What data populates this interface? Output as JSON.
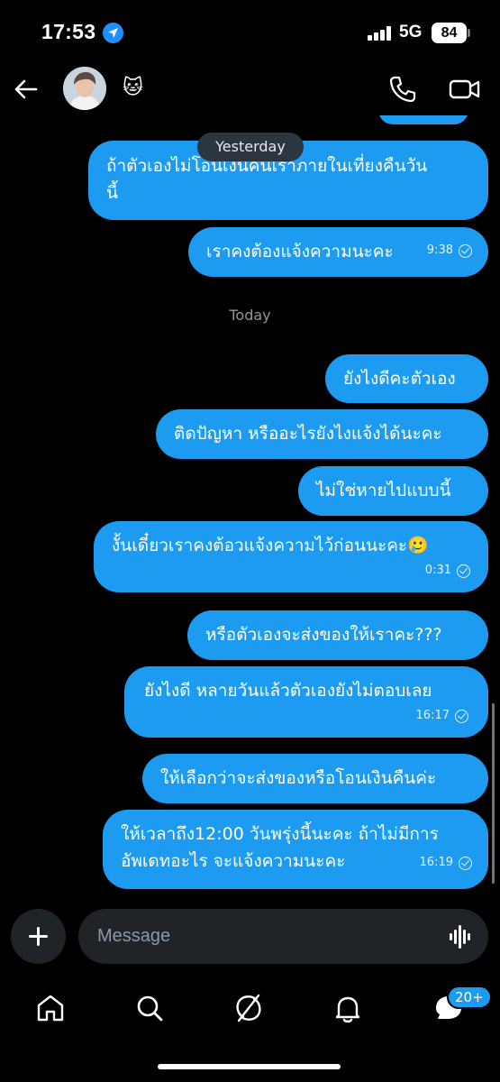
{
  "status_bar": {
    "time": "17:53",
    "network": "5G",
    "battery": "84",
    "signal_bars": 4,
    "location_icon": "location-arrow-icon"
  },
  "header": {
    "back_icon": "back-arrow-icon",
    "contact_emoji": "🐱",
    "call_icon": "phone-icon",
    "video_icon": "video-camera-icon"
  },
  "chat": {
    "yesterday_label": "Yesterday",
    "today_label": "Today",
    "messages": [
      {
        "lines": [
          "ถ้าตัวเองไม่โอนเงินคืนเราภายในเที่ยงคืนวัน",
          "นี้"
        ],
        "time": ""
      },
      {
        "lines": [
          "เราคงต้องแจ้งความนะคะ"
        ],
        "time": "9:38"
      },
      {
        "lines": [
          "ยังไงดีคะตัวเอง"
        ],
        "time": ""
      },
      {
        "lines": [
          "ติดปัญหา หรืออะไรยังไงแจ้งได้นะคะ"
        ],
        "time": ""
      },
      {
        "lines": [
          "ไม่ใช่หายไปแบบนี้"
        ],
        "time": ""
      },
      {
        "lines": [
          "งั้นเดี๋ยวเราคงต้อวแจ้งความไว้ก่อนนะคะ🥲"
        ],
        "time": "0:31"
      },
      {
        "lines": [
          "หรือตัวเองจะส่งของให้เราคะ???"
        ],
        "time": ""
      },
      {
        "lines": [
          "ยังไงดี หลายวันแล้วตัวเองยังไม่ตอบเลย"
        ],
        "time": "16:17"
      },
      {
        "lines": [
          "ให้เลือกว่าจะส่งของหรือโอนเงินคืนค่ะ"
        ],
        "time": ""
      },
      {
        "lines": [
          "ให้เวลาถึง12:00 วันพรุ่งนี้นะคะ ถ้าไม่มีการ",
          "อัพเดทอะไร  จะแจ้งความนะคะ"
        ],
        "time": "16:19"
      }
    ],
    "accent_color": "#1d9bf0"
  },
  "composer": {
    "placeholder": "Message",
    "plus_icon": "plus-icon",
    "voice_icon": "voice-waveform-icon"
  },
  "tab_bar": {
    "tabs": [
      "home-icon",
      "search-icon",
      "grok-icon",
      "notifications-icon",
      "messages-icon"
    ],
    "messages_badge": "20+"
  }
}
